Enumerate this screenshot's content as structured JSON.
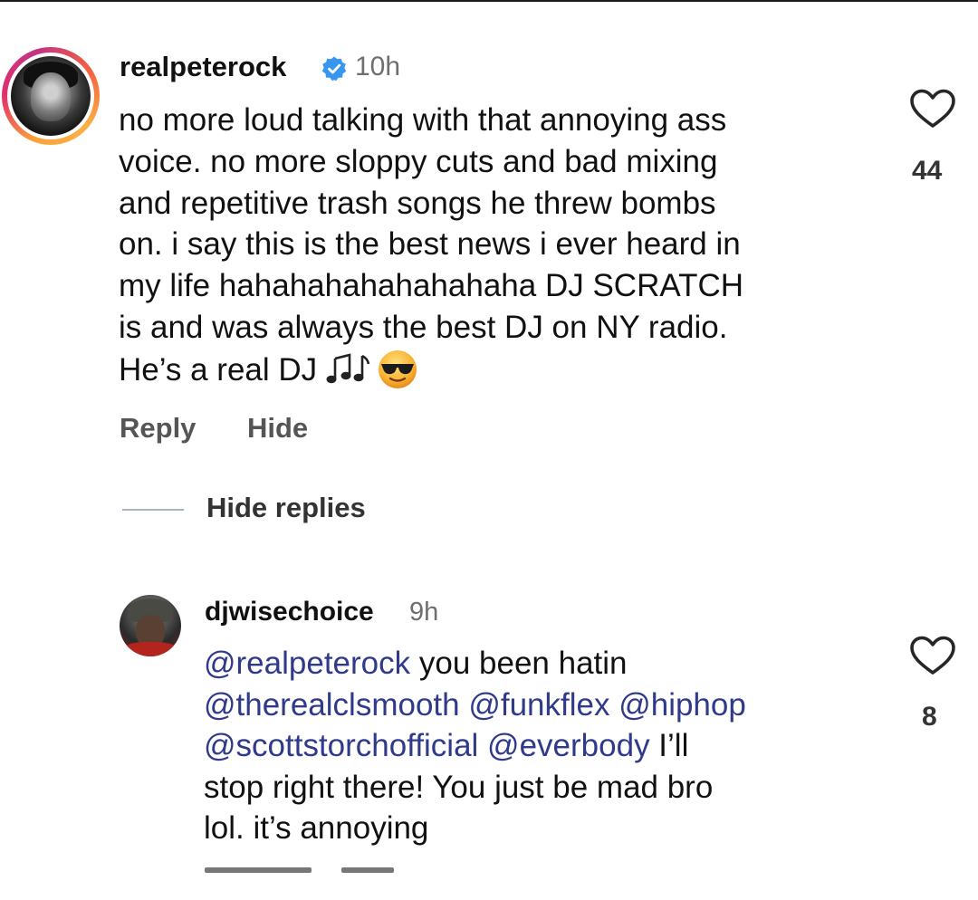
{
  "main_comment": {
    "username": "realpeterock",
    "verified": true,
    "time": "10h",
    "text": "no more loud talking with that annoying ass\nvoice. no more sloppy cuts and bad mixing\nand repetitive trash songs he threw bombs\non. i say this is the best news i ever heard in\nmy life hahahahahahahahaha DJ SCRATCH\nis and was always the best DJ on NY radio.\nHe’s a real DJ",
    "emojis": [
      "musical-notes",
      "smiling-face-with-sunglasses"
    ],
    "likes": "44",
    "actions": {
      "reply": "Reply",
      "hide": "Hide"
    }
  },
  "replies_toggle": {
    "label": "Hide replies"
  },
  "reply_comment": {
    "username": "djwisechoice",
    "time": "9h",
    "segments": [
      {
        "text": "@realpeterock",
        "mention": true
      },
      {
        "text": " you been hatin\n",
        "mention": false
      },
      {
        "text": "@therealclsmooth @funkflex @hiphop\n@scottstorchofficial @everbody",
        "mention": true
      },
      {
        "text": " I’ll\nstop right there! You just be mad bro\nlol. it’s annoying",
        "mention": false
      }
    ],
    "likes": "8"
  },
  "colors": {
    "mention": "#2f3a8a",
    "verified_badge": "#3797f0",
    "muted_text": "#6e6e6e",
    "story_ring": [
      "#f9a23b",
      "#e1306c",
      "#c13584"
    ]
  }
}
